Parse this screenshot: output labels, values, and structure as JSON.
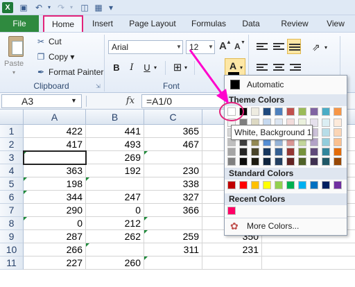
{
  "quick_access": {
    "save_icon": "save-icon",
    "undo_icon": "undo-icon",
    "redo_icon": "redo-icon"
  },
  "tabs": [
    {
      "label": "File"
    },
    {
      "label": "Home"
    },
    {
      "label": "Insert"
    },
    {
      "label": "Page Layout"
    },
    {
      "label": "Formulas"
    },
    {
      "label": "Data"
    },
    {
      "label": "Review"
    },
    {
      "label": "View"
    }
  ],
  "clipboard": {
    "paste": "Paste",
    "cut": "Cut",
    "copy": "Copy ▾",
    "format_painter": "Format Painter",
    "group_label": "Clipboard"
  },
  "font": {
    "family": "Arial",
    "size": "12",
    "bold": "B",
    "italic": "I",
    "underline": "U",
    "group_label": "Font",
    "grow": "A",
    "shrink": "A",
    "font_color": "A"
  },
  "formula_bar": {
    "name_box": "A3",
    "fx": "fx",
    "formula": "=A1/0"
  },
  "columns": [
    "A",
    "B",
    "C",
    "D"
  ],
  "rows": [
    {
      "n": "1",
      "a": "422",
      "b": "441",
      "c": "365",
      "d": ""
    },
    {
      "n": "2",
      "a": "417",
      "b": "493",
      "c": "467",
      "d": ""
    },
    {
      "n": "3",
      "a": "",
      "b": "269",
      "c": "",
      "d": ""
    },
    {
      "n": "4",
      "a": "363",
      "b": "192",
      "c": "230",
      "d": ""
    },
    {
      "n": "5",
      "a": "198",
      "b": "",
      "c": "338",
      "d": ""
    },
    {
      "n": "6",
      "a": "344",
      "b": "247",
      "c": "327",
      "d": ""
    },
    {
      "n": "7",
      "a": "290",
      "b": "0",
      "c": "366",
      "d": ""
    },
    {
      "n": "8",
      "a": "0",
      "b": "212",
      "c": "",
      "d": ""
    },
    {
      "n": "9",
      "a": "287",
      "b": "262",
      "c": "259",
      "d": "350"
    },
    {
      "n": "10",
      "a": "266",
      "b": "",
      "c": "311",
      "d": "231"
    },
    {
      "n": "11",
      "a": "227",
      "b": "260",
      "c": "",
      "d": ""
    }
  ],
  "color_menu": {
    "automatic": "Automatic",
    "theme_colors": "Theme Colors",
    "standard_colors": "Standard Colors",
    "recent_colors": "Recent Colors",
    "more_colors": "More Colors...",
    "tooltip": "White, Background 1",
    "theme_top": [
      "#ffffff",
      "#000000",
      "#eeece1",
      "#1f497d",
      "#4f81bd",
      "#c0504d",
      "#9bbb59",
      "#8064a2",
      "#4bacc6",
      "#f79646"
    ],
    "theme_shades": [
      [
        "#f2f2f2",
        "#7f7f7f",
        "#ddd9c3",
        "#c6d9f0",
        "#dbe5f1",
        "#f2dcdb",
        "#ebf1dd",
        "#e5e0ec",
        "#dbeef3",
        "#fdeada"
      ],
      [
        "#d8d8d8",
        "#595959",
        "#c4bd97",
        "#8db3e2",
        "#b8cce4",
        "#e5b9b7",
        "#d7e3bc",
        "#ccc1d9",
        "#b7dde8",
        "#fbd5b5"
      ],
      [
        "#bfbfbf",
        "#3f3f3f",
        "#938953",
        "#548dd4",
        "#95b3d7",
        "#d99694",
        "#c3d69b",
        "#b2a2c7",
        "#92cddc",
        "#fac08f"
      ],
      [
        "#a5a5a5",
        "#262626",
        "#494429",
        "#17365d",
        "#366092",
        "#953734",
        "#76923c",
        "#5f497a",
        "#31859b",
        "#e36c09"
      ],
      [
        "#7f7f7f",
        "#0c0c0c",
        "#1d1b10",
        "#0f243e",
        "#244061",
        "#632423",
        "#4f6128",
        "#3f3151",
        "#205867",
        "#974806"
      ]
    ],
    "standard": [
      "#c00000",
      "#ff0000",
      "#ffc000",
      "#ffff00",
      "#92d050",
      "#00b050",
      "#00b0f0",
      "#0070c0",
      "#002060",
      "#7030a0"
    ],
    "recent": [
      "#ff0066"
    ]
  }
}
